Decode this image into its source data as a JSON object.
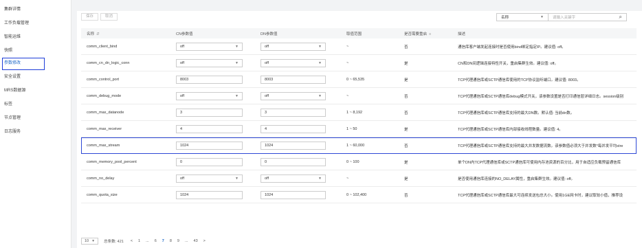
{
  "sidebar": {
    "items": [
      {
        "label": "集群详情",
        "active": false
      },
      {
        "label": "工作负载管理",
        "active": false
      },
      {
        "label": "智能运维",
        "active": false
      },
      {
        "label": "快照",
        "active": false
      },
      {
        "label": "参数修改",
        "active": true
      },
      {
        "label": "安全设置",
        "active": false
      },
      {
        "label": "MRS数据源",
        "active": false
      },
      {
        "label": "标签",
        "active": false
      },
      {
        "label": "节点管理",
        "active": false
      },
      {
        "label": "日志服务",
        "active": false
      }
    ]
  },
  "toolbar": {
    "save_label": "保存",
    "cancel_label": "取消"
  },
  "filter": {
    "select_value": "名称",
    "search_placeholder": "请输入关键字"
  },
  "table": {
    "headers": {
      "name": "名称",
      "cn": "CN参数值",
      "dn": "DN参数值",
      "range": "取值范围",
      "restart": "是否需要重启",
      "desc": "描述"
    },
    "rows": [
      {
        "name": "comm_client_bind",
        "cn": "off",
        "dn": "off",
        "type": "select",
        "range": "~",
        "restart": "否",
        "desc": "通信库客户端发起连接时是否使用bind绑定指定IP。建议值: off。"
      },
      {
        "name": "comm_cn_dn_logic_conn",
        "cn": "off",
        "dn": "off",
        "type": "select",
        "range": "~",
        "restart": "是",
        "desc": "CN和DN间逻辑连接特性开关，重启集群生效。建议值: off。"
      },
      {
        "name": "comm_control_port",
        "cn": "8003",
        "dn": "8003",
        "type": "input",
        "range": "0 ~ 65,535",
        "restart": "是",
        "desc": "TCP代理通信库或SCTP通信库使用的TCP协议监听端口。建议值: 8003。"
      },
      {
        "name": "comm_debug_mode",
        "cn": "off",
        "dn": "off",
        "type": "select",
        "range": "~",
        "restart": "否",
        "desc": "TCP代理通信库或SCTP通信库debug模式开关，该参数设置是否打印通信层详细日志。session级别"
      },
      {
        "name": "comm_max_datanode",
        "cn": "3",
        "dn": "3",
        "type": "input",
        "range": "1 ~ 8,192",
        "restart": "否",
        "desc": "TCP代理通信库或SCTP通信库支持的最大DN数。默认值: 当前dn数。"
      },
      {
        "name": "comm_max_receiver",
        "cn": "4",
        "dn": "4",
        "type": "input",
        "range": "1 ~ 50",
        "restart": "是",
        "desc": "TCP代理通信库或SCTP通信库内部接收线程数量。建议值: 4。"
      },
      {
        "name": "comm_max_stream",
        "cn": "1024",
        "dn": "1024",
        "type": "input",
        "range": "1 ~ 60,000",
        "restart": "否",
        "desc": "TCP代理通信库或SCTP通信库支持的最大并发数据流数。该参数值必须大于并发数*每并发平均stre"
      },
      {
        "name": "comm_memory_pool_percent",
        "cn": "0",
        "dn": "0",
        "type": "input",
        "range": "0 ~ 100",
        "restart": "是",
        "desc": "单个DN内TCP代理通信库或SCTP通信库可使用内存池资源的百分比，用于自适应负载预留通信库"
      },
      {
        "name": "comm_no_delay",
        "cn": "off",
        "dn": "off",
        "type": "select",
        "range": "~",
        "restart": "是",
        "desc": "是否使用通信库连接的NO_DELAY属性，重启集群生效。建议值: off。"
      },
      {
        "name": "comm_quota_size",
        "cn": "1024",
        "dn": "1024",
        "type": "input",
        "range": "0 ~ 102,400",
        "restart": "否",
        "desc": "TCP代理通信库或SCTP通信库最大可连续发送包总大小。使用1GE网卡时，建议取较小值，推荐设"
      }
    ]
  },
  "pager": {
    "page_size": "10",
    "total": "总条数: 421",
    "prev": "<",
    "pages": [
      "1",
      "...",
      "6",
      "7",
      "8",
      "9",
      "...",
      "43"
    ],
    "current": "7",
    "next": ">"
  }
}
